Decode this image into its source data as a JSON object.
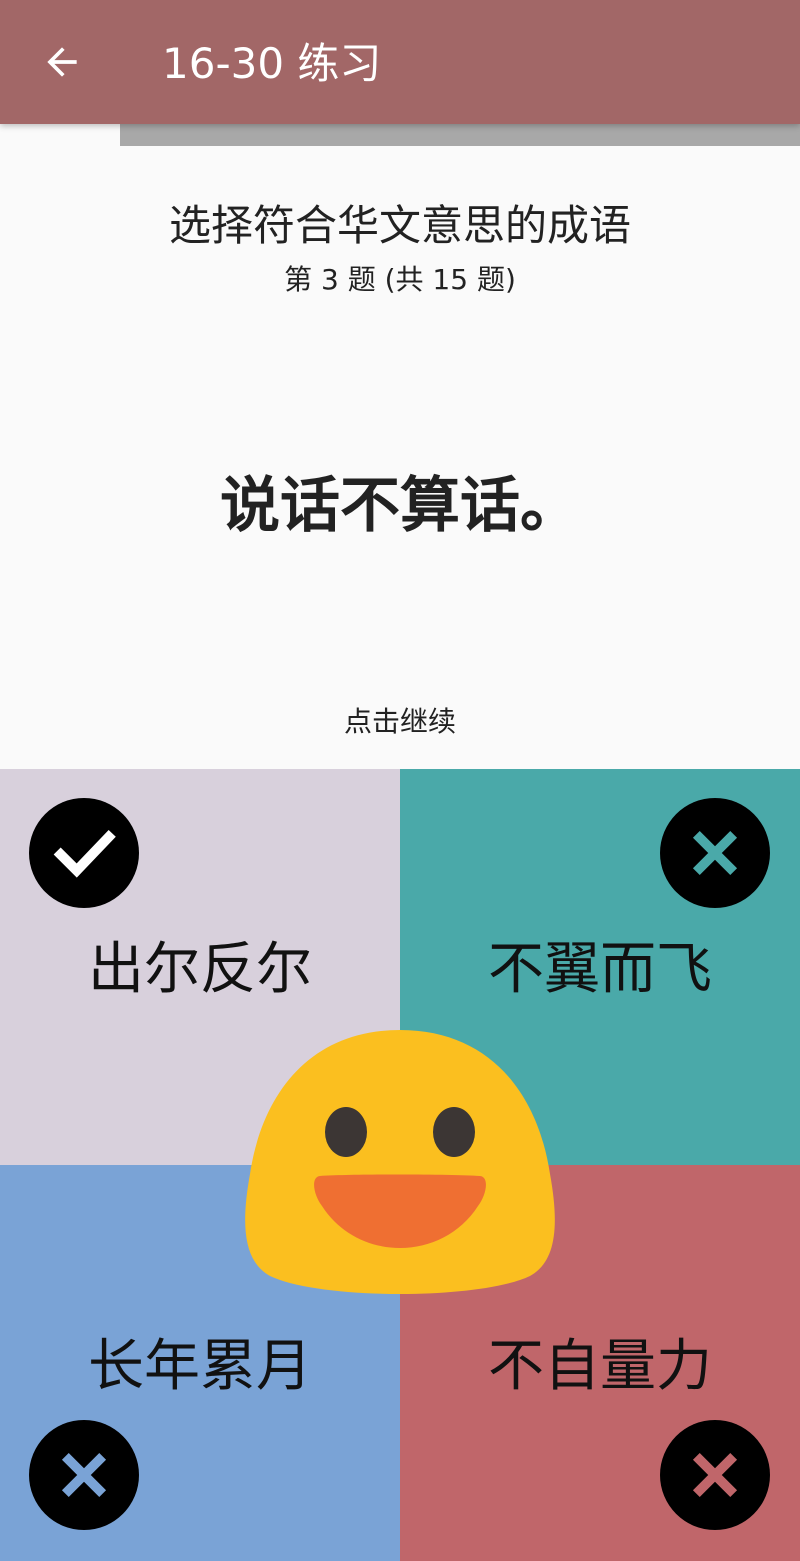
{
  "appbar": {
    "title": "16-30 练习",
    "back_icon": "arrow-left-icon"
  },
  "progress": {
    "fraction": 0.15
  },
  "question": {
    "instruction": "选择符合华文意思的成语",
    "counter": "第 3 题 (共 15 题)",
    "prompt": "说话不算话。",
    "tap_continue": "点击继续"
  },
  "choices": [
    {
      "label": "出尔反尔",
      "status": "correct",
      "icon": "check-icon",
      "bg_color": "#d8d0dc",
      "mark_color": "#ffffff"
    },
    {
      "label": "不翼而飞",
      "status": "wrong",
      "icon": "close-icon",
      "bg_color": "#4aa9a9",
      "mark_color": "#4aa9a9"
    },
    {
      "label": "长年累月",
      "status": "wrong",
      "icon": "close-icon",
      "bg_color": "#7aa3d6",
      "mark_color": "#7aa3d6"
    },
    {
      "label": "不自量力",
      "status": "wrong",
      "icon": "close-icon",
      "bg_color": "#c0666a",
      "mark_color": "#c0666a"
    }
  ],
  "feedback": {
    "icon": "smiling-face-emoji"
  },
  "colors": {
    "appbar": "#a26767",
    "background": "#fafafa",
    "badge": "#000000"
  }
}
